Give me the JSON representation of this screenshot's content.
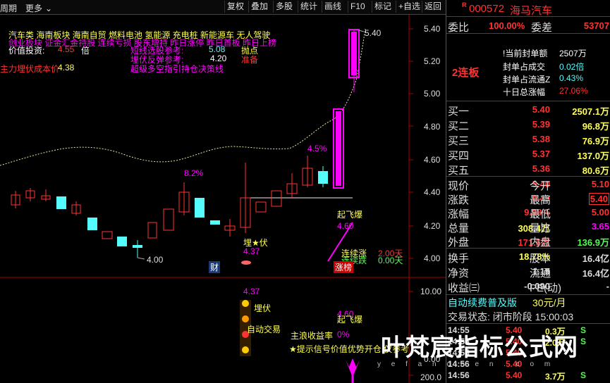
{
  "toolbar": {
    "left_items": [
      "周期",
      "更多"
    ],
    "buttons": [
      "复权",
      "叠加",
      "多股",
      "统计",
      "画线",
      "F10",
      "标记",
      "+自选",
      "返回"
    ]
  },
  "price_axis": [
    "5.40",
    "5.20",
    "5.00",
    "4.80",
    "4.60",
    "4.40",
    "4.20",
    "4.00"
  ],
  "volume_axis": [
    "10.00",
    "0.00",
    "200.0"
  ],
  "overlay": {
    "row1": "汽车类    海南板块  海南自贸 燃料电池 氢能源 充电桩 新能源车 无人驾驶",
    "row2": "创业板块 证金汇金持股 连续亏损 股东增持 昨日涨停 昨日首板 昨日上榜",
    "value_label": "价值投资:",
    "value_num": "4.55",
    "value_unit": "倍",
    "short_line": "短线选股参考:",
    "short_num": "5.08",
    "short_tag": "抛点",
    "ambush": "埋伏反弹参考:",
    "ambush_num": "4.20",
    "ambush_tag": "准备",
    "main_force": "主力埋伏成本价",
    "main_force_num": "4.38",
    "super": "超级多空指引持仓决策线",
    "pct1": "8.2%",
    "pct2": "4.5%",
    "high_label": "5.40",
    "low_label": "4.00",
    "qifei": "起飞爆",
    "qifei_num": "4.60",
    "maifu": "埋★伏",
    "maifu_num": "4.37",
    "lianxu1": "连续涨",
    "lianxu2": "连续跌",
    "days1": "2.00天",
    "days2": "0.00天",
    "zhangbang": "涨榜",
    "cai": "财",
    "v_maifu": "埋伏",
    "v_maifu_num": "4.37",
    "v_qifei": "起飞爆",
    "v_qifei_num": "4.60",
    "v_auto": "自动交易",
    "v_profit": "主浪收益率",
    "v_profit_num": "0%",
    "v_signal": "★提示信号价值优势开仓,仅参考"
  },
  "quote": {
    "code": "000572",
    "name": "海马汽车",
    "r_tag": "R",
    "webi_label": "委比",
    "webi": "100.00%",
    "weicha_label": "委差",
    "weicha": "53707",
    "board_tag": "2连板",
    "seal_rows": [
      {
        "label": "当前封单额",
        "value": "2507万"
      },
      {
        "label": "封单占成交",
        "value": "0.02倍"
      },
      {
        "label": "封单占流通Z",
        "value": "0.43%"
      },
      {
        "label": "十日总涨幅",
        "value": "27.06%"
      }
    ],
    "bids": [
      {
        "label": "买一",
        "price": "5.40",
        "vol": "2507.1万"
      },
      {
        "label": "买二",
        "price": "5.39",
        "vol": "96.8万"
      },
      {
        "label": "买三",
        "price": "5.38",
        "vol": "76.9万"
      },
      {
        "label": "买四",
        "price": "5.37",
        "vol": "137.0万"
      },
      {
        "label": "买五",
        "price": "5.36",
        "vol": "80.6万"
      }
    ],
    "stats": [
      {
        "k1": "现价",
        "v1": "5.40",
        "k2": "今开",
        "v2": "5.10"
      },
      {
        "k1": "涨跌",
        "v1": "0.49",
        "k2": "最高",
        "v2": "5.40"
      },
      {
        "k1": "涨幅",
        "v1": "9.98%",
        "k2": "最低",
        "v2": "5.00"
      },
      {
        "k1": "总量",
        "v1": "308.4万",
        "k2": "量比",
        "v2": "3.65"
      },
      {
        "k1": "外盘",
        "v1": "171.5万",
        "k2": "内盘",
        "v2": "136.9万"
      }
    ],
    "stats2": [
      {
        "k1": "换手",
        "v1": "18.78%",
        "k2": "股本",
        "v2": "16.4亿"
      },
      {
        "k1": "净资",
        "v1": "1.19",
        "k2": "流通",
        "v2": "16.4亿"
      },
      {
        "k1": "收益㈢",
        "v1": "-0.090",
        "k2": "PE(动)",
        "v2": "-"
      }
    ],
    "renew": "自动续费普及版",
    "renew_price": "30元/月",
    "status": "交易状态: 闭市阶段 15:00:03",
    "trades": [
      {
        "time": "14:55",
        "price": "5.40",
        "vol": "0.3万",
        "side": "S"
      },
      {
        "time": "14:55",
        "price": "5.40",
        "vol": "2.0万",
        "side": "S"
      },
      {
        "time": "14:55",
        "price": "5.40",
        "vol": "",
        "side": ""
      },
      {
        "time": "14:56",
        "price": "5.40",
        "vol": "",
        "side": ""
      },
      {
        "time": "14:56",
        "price": "5.40",
        "vol": "3.7万",
        "side": "S"
      }
    ]
  },
  "watermark": {
    "title": "叶梵宸指标公式网",
    "url": "y e f a n c h e n . c o m"
  },
  "colors": {
    "up": "#ff3333",
    "down": "#54fcfc",
    "limit": "#ff00ff",
    "yellow": "#ffff54",
    "ma": "#e8e8a0"
  }
}
